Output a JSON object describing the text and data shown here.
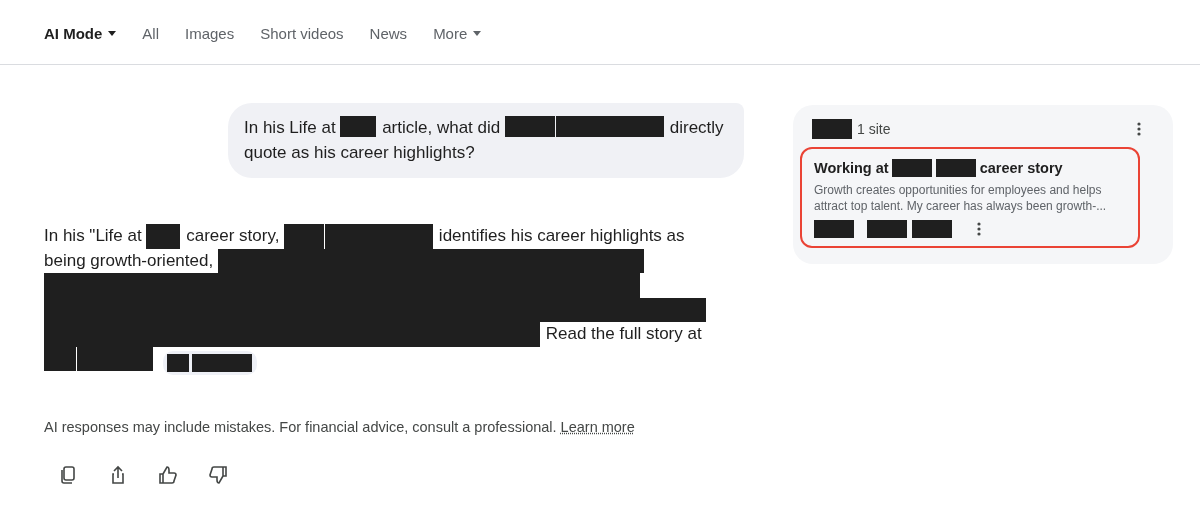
{
  "tabs": [
    {
      "label": "AI Mode",
      "selected": true,
      "has_menu": true
    },
    {
      "label": "All",
      "selected": false,
      "has_menu": false
    },
    {
      "label": "Images",
      "selected": false,
      "has_menu": false
    },
    {
      "label": "Short videos",
      "selected": false,
      "has_menu": false
    },
    {
      "label": "News",
      "selected": false,
      "has_menu": false
    },
    {
      "label": "More",
      "selected": false,
      "has_menu": true
    }
  ],
  "query": [
    {
      "kind": "text",
      "text": "In his Life at"
    },
    {
      "kind": "redaction"
    },
    {
      "kind": "text",
      "text": "article, what did"
    },
    {
      "kind": "redaction"
    },
    {
      "kind": "redaction"
    },
    {
      "kind": "text",
      "text": "directly"
    },
    {
      "kind": "text",
      "text": "quote as his career highlights?"
    }
  ],
  "answer": [
    {
      "kind": "text",
      "text": "In his \"Life at"
    },
    {
      "kind": "redaction"
    },
    {
      "kind": "text",
      "text": "career story,"
    },
    {
      "kind": "redaction"
    },
    {
      "kind": "redaction"
    },
    {
      "kind": "text",
      "text": "identifies his career highlights as"
    },
    {
      "kind": "text",
      "text": "being growth-oriented,"
    },
    {
      "kind": "redaction"
    },
    {
      "kind": "redaction"
    },
    {
      "kind": "redaction"
    },
    {
      "kind": "redaction"
    },
    {
      "kind": "text",
      "text": "Read the full story at"
    },
    {
      "kind": "redaction"
    },
    {
      "kind": "redaction"
    },
    {
      "kind": "chip"
    }
  ],
  "disclaimer": {
    "text": "AI responses may include mistakes. For financial advice, consult a professional.",
    "link": "Learn more"
  },
  "actions": [
    {
      "kind": "copy"
    },
    {
      "kind": "share"
    },
    {
      "kind": "thumbs_up"
    },
    {
      "kind": "thumbs_down"
    }
  ],
  "sources": {
    "count": "1 site",
    "items": [
      {
        "title_start": "Working at",
        "title_end": "career story",
        "snippet": "Growth creates opportunities for employees and helps attract top talent. My career has always been growth-...",
        "selected": true
      }
    ]
  }
}
